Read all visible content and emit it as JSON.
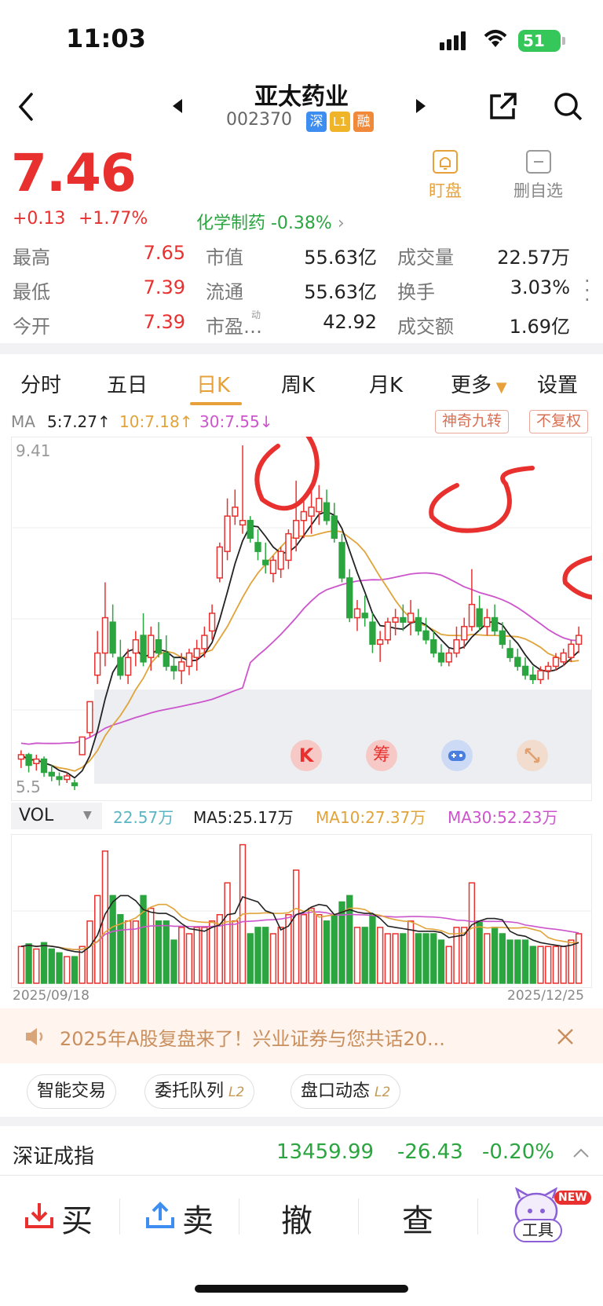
{
  "status": {
    "time": "11:03",
    "battery": "51"
  },
  "header": {
    "title": "亚太药业",
    "code": "002370",
    "tags": [
      "深",
      "L1",
      "融"
    ]
  },
  "quote": {
    "price": "7.46",
    "change": "+0.13",
    "change_pct": "+1.77%",
    "sector": "化学制药 -0.38%",
    "watch_label": "盯盘",
    "remove_label": "删自选"
  },
  "stats": {
    "rows": [
      {
        "l1": "最高",
        "v1": "7.65",
        "l2": "市值",
        "v2": "55.63亿",
        "l3": "成交量",
        "v3": "22.57万"
      },
      {
        "l1": "最低",
        "v1": "7.39",
        "l2": "流通",
        "v2": "55.63亿",
        "l3": "换手",
        "v3": "3.03%"
      },
      {
        "l1": "今开",
        "v1": "7.39",
        "l2": "市盈…",
        "v2": "42.92",
        "l3": "成交额",
        "v3": "1.69亿"
      }
    ],
    "pe_sup": "动"
  },
  "tabs": [
    "分时",
    "五日",
    "日K",
    "周K",
    "月K",
    "更多",
    "设置"
  ],
  "ma": {
    "label": "MA",
    "ma5": "5:7.27↑",
    "ma10": "10:7.18↑",
    "ma30": "30:7.55↓",
    "chip1": "神奇九转",
    "chip2": "不复权"
  },
  "chart": {
    "y_high": "9.41",
    "y_low": "5.5",
    "float_btns": [
      "K",
      "筹"
    ]
  },
  "vol": {
    "label": "VOL",
    "value": "22.57万",
    "ma5": "MA5:25.17万",
    "ma10": "MA10:27.37万",
    "ma30": "MA30:52.23万"
  },
  "dates": {
    "start": "2025/09/18",
    "end": "2025/12/25"
  },
  "banner": {
    "text": "2025年A股复盘来了！兴业证券与您共话20..."
  },
  "pills": [
    {
      "label": "智能交易",
      "l2": ""
    },
    {
      "label": "委托队列",
      "l2": "L2"
    },
    {
      "label": "盘口动态",
      "l2": "L2"
    }
  ],
  "index": {
    "name": "深证成指",
    "value": "13459.99",
    "change": "-26.43",
    "pct": "-0.20%"
  },
  "bottom": {
    "buy": "买",
    "sell": "卖",
    "cancel": "撤",
    "query": "查",
    "tools": "工具",
    "new_badge": "NEW"
  },
  "colors": {
    "up": "#e8312e",
    "down": "#2aa53f",
    "ma5": "#222222",
    "ma10": "#e0a43a",
    "ma30": "#cc55cc"
  },
  "chart_data": {
    "type": "candlestick",
    "x_range": [
      "2025/09/18",
      "2025/12/25"
    ],
    "ylim": [
      5.5,
      9.41
    ],
    "candles": [
      [
        5.85,
        5.95,
        5.75,
        5.9
      ],
      [
        5.9,
        5.92,
        5.7,
        5.78
      ],
      [
        5.8,
        5.9,
        5.72,
        5.85
      ],
      [
        5.85,
        5.88,
        5.65,
        5.7
      ],
      [
        5.7,
        5.78,
        5.6,
        5.66
      ],
      [
        5.65,
        5.7,
        5.55,
        5.62
      ],
      [
        5.62,
        5.7,
        5.58,
        5.66
      ],
      [
        5.58,
        5.62,
        5.5,
        5.55
      ],
      [
        5.9,
        6.1,
        5.9,
        6.1
      ],
      [
        6.15,
        6.5,
        6.1,
        6.5
      ],
      [
        6.8,
        7.3,
        6.7,
        7.05
      ],
      [
        7.05,
        7.85,
        6.9,
        7.45
      ],
      [
        7.4,
        7.6,
        7.0,
        7.05
      ],
      [
        7.0,
        7.2,
        6.75,
        6.8
      ],
      [
        6.8,
        7.1,
        6.7,
        7.0
      ],
      [
        7.05,
        7.3,
        6.9,
        7.2
      ],
      [
        7.25,
        7.5,
        6.9,
        6.95
      ],
      [
        7.0,
        7.35,
        6.85,
        7.25
      ],
      [
        7.2,
        7.4,
        7.0,
        7.05
      ],
      [
        7.05,
        7.25,
        6.85,
        6.9
      ],
      [
        6.9,
        7.0,
        6.75,
        6.85
      ],
      [
        6.85,
        7.05,
        6.7,
        6.95
      ],
      [
        6.9,
        7.1,
        6.8,
        7.05
      ],
      [
        7.0,
        7.2,
        6.85,
        7.1
      ],
      [
        7.1,
        7.35,
        7.0,
        7.25
      ],
      [
        7.3,
        7.6,
        7.2,
        7.5
      ],
      [
        7.9,
        8.3,
        7.85,
        8.25
      ],
      [
        8.2,
        8.8,
        8.1,
        8.6
      ],
      [
        8.6,
        8.9,
        8.5,
        8.7
      ],
      [
        8.5,
        9.4,
        8.4,
        8.55
      ],
      [
        8.55,
        8.6,
        8.3,
        8.35
      ],
      [
        8.3,
        8.45,
        8.1,
        8.2
      ],
      [
        8.1,
        8.3,
        7.95,
        8.05
      ],
      [
        7.95,
        8.15,
        7.85,
        8.1
      ],
      [
        8.0,
        8.25,
        7.9,
        8.2
      ],
      [
        8.1,
        8.45,
        8.0,
        8.4
      ],
      [
        8.35,
        9.0,
        8.2,
        8.55
      ],
      [
        8.55,
        8.8,
        8.35,
        8.65
      ],
      [
        8.6,
        8.9,
        8.4,
        8.7
      ],
      [
        8.65,
        8.95,
        8.5,
        8.8
      ],
      [
        8.75,
        8.9,
        8.5,
        8.55
      ],
      [
        8.6,
        8.75,
        8.3,
        8.35
      ],
      [
        8.3,
        8.4,
        7.85,
        7.9
      ],
      [
        7.9,
        8.0,
        7.4,
        7.45
      ],
      [
        7.45,
        7.65,
        7.3,
        7.55
      ],
      [
        7.5,
        7.7,
        7.35,
        7.45
      ],
      [
        7.4,
        7.5,
        7.05,
        7.15
      ],
      [
        7.15,
        7.3,
        6.95,
        7.2
      ],
      [
        7.2,
        7.45,
        7.15,
        7.4
      ],
      [
        7.4,
        7.55,
        7.25,
        7.45
      ],
      [
        7.45,
        7.6,
        7.3,
        7.4
      ],
      [
        7.4,
        7.65,
        7.25,
        7.5
      ],
      [
        7.45,
        7.55,
        7.25,
        7.3
      ],
      [
        7.3,
        7.45,
        7.15,
        7.2
      ],
      [
        7.2,
        7.3,
        7.0,
        7.05
      ],
      [
        7.05,
        7.15,
        6.9,
        6.95
      ],
      [
        6.95,
        7.1,
        6.9,
        7.05
      ],
      [
        7.05,
        7.35,
        7.0,
        7.2
      ],
      [
        7.2,
        7.45,
        7.1,
        7.35
      ],
      [
        7.35,
        8.0,
        7.3,
        7.6
      ],
      [
        7.55,
        7.7,
        7.3,
        7.35
      ],
      [
        7.35,
        7.55,
        7.25,
        7.45
      ],
      [
        7.45,
        7.6,
        7.25,
        7.3
      ],
      [
        7.3,
        7.4,
        7.1,
        7.15
      ],
      [
        7.1,
        7.2,
        6.95,
        7.0
      ],
      [
        7.0,
        7.1,
        6.85,
        6.9
      ],
      [
        6.9,
        7.0,
        6.75,
        6.8
      ],
      [
        6.8,
        6.9,
        6.7,
        6.75
      ],
      [
        6.75,
        6.9,
        6.7,
        6.85
      ],
      [
        6.85,
        6.95,
        6.75,
        6.9
      ],
      [
        6.9,
        7.05,
        6.85,
        7.0
      ],
      [
        6.95,
        7.1,
        6.9,
        7.05
      ],
      [
        7.0,
        7.2,
        6.95,
        7.15
      ],
      [
        7.15,
        7.35,
        7.05,
        7.25
      ]
    ],
    "ma5_label": "MA5",
    "ma10_label": "MA10",
    "ma30_label": "MA30"
  }
}
